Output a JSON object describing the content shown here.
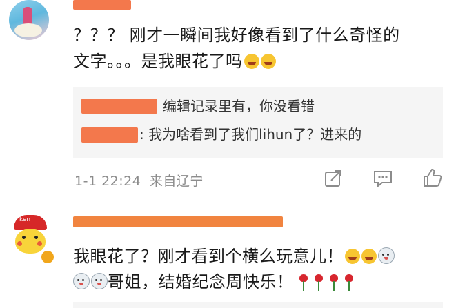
{
  "comment1": {
    "text_line1": "？？？ 刚才一瞬间我好像看到了什么奇怪的",
    "text_line2": "文字。。。是我眼花了吗",
    "replies": [
      {
        "text": "编辑记录里有，你没看错"
      },
      {
        "text": ": 我为啥看到了我们lihun了？进来的"
      }
    ],
    "timestamp": "1-1 22:24",
    "location": "来自辽宁",
    "actions": [
      "share-icon",
      "comment-icon",
      "like-icon"
    ]
  },
  "comment2": {
    "text_line1": "我眼花了？刚才看到个横么玩意儿！",
    "text_line2": "哥姐，结婚纪念周快乐！",
    "avatar_badge": "ken"
  },
  "colors": {
    "redaction": "#f26d3d",
    "reply_bg": "#f5f5f5",
    "meta": "#8c8c8c"
  }
}
